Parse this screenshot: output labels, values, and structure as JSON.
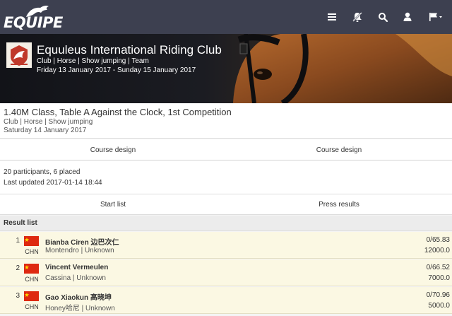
{
  "app": {
    "logo_text": "EQUIPE"
  },
  "nav": {
    "icons": [
      "menu-icon",
      "no-bell-icon",
      "search-icon",
      "user-icon",
      "flag-icon"
    ]
  },
  "event": {
    "title": "Equuleus International Riding Club",
    "tags": "Club | Horse | Show jumping | Team",
    "dates": "Friday 13 January 2017 - Sunday 15 January 2017"
  },
  "competition": {
    "title": "1.40M Class, Table A Against the Clock, 1st Competition",
    "tags": "Club | Horse | Show jumping",
    "date": "Saturday 14 January 2017"
  },
  "course_links": [
    "Course design",
    "Course design"
  ],
  "info": {
    "participants": "20 participants, 6 placed",
    "updated": "Last updated 2017-01-14 18:44"
  },
  "result_links": [
    "Start list",
    "Press results"
  ],
  "result_list": {
    "header": "Result list",
    "rows": [
      {
        "rank": "1",
        "nation": "CHN",
        "rider": "Bianba Ciren 边巴次仁",
        "horse": "Montendro | Unknown",
        "score": "0/65.83",
        "money": "12000.0"
      },
      {
        "rank": "2",
        "nation": "CHN",
        "rider": "Vincent Vermeulen",
        "horse": "Cassina | Unknown",
        "score": "0/66.52",
        "money": "7000.0"
      },
      {
        "rank": "3",
        "nation": "CHN",
        "rider": "Gao Xiaokun 高晓坤",
        "horse": "Honey哈尼 | Unknown",
        "score": "0/70.96",
        "money": "5000.0"
      }
    ]
  },
  "colors": {
    "topbar": "#3d4050",
    "highlight_row": "#fbf8e3",
    "flag_red": "#de2910",
    "flag_star": "#ffde00"
  }
}
